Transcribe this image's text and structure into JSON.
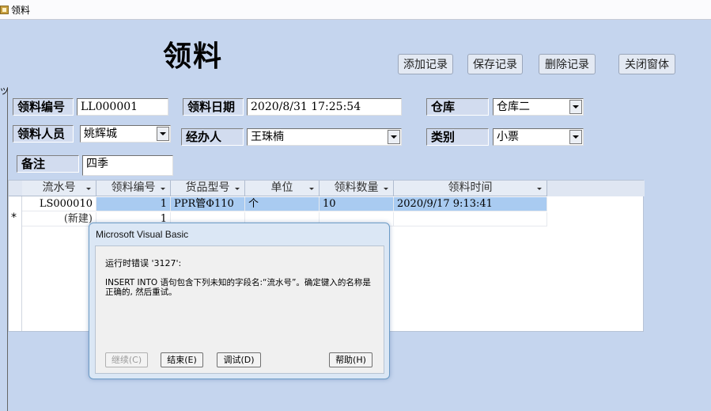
{
  "window": {
    "title": "领料"
  },
  "left_edge_mark": "ツ",
  "form": {
    "title": "领料"
  },
  "toolbar": {
    "add_label": "添加记录",
    "save_label": "保存记录",
    "delete_label": "删除记录",
    "close_label": "关闭窗体"
  },
  "fields": {
    "issue_no_label": "领料编号",
    "issue_no_value": "LL000001",
    "issue_date_label": "领料日期",
    "issue_date_value": "2020/8/31 17:25:54",
    "warehouse_label": "仓库",
    "warehouse_value": "仓库二",
    "requester_label": "领料人员",
    "requester_value": "姚辉城",
    "handler_label": "经办人",
    "handler_value": "王珠楠",
    "category_label": "类别",
    "category_value": "小票",
    "note_label": "备注",
    "note_value": "四季"
  },
  "grid": {
    "columns": [
      "流水号",
      "领料编号",
      "货品型号",
      "单位",
      "领料数量",
      "领料时间"
    ],
    "rows": [
      {
        "serial": "LS000010",
        "issue_no": "1",
        "model": "PPR管Φ110",
        "unit": "个",
        "qty": "10",
        "time": "2020/9/17 9:13:41"
      }
    ],
    "new_row": {
      "marker": "*",
      "serial": "(新建)",
      "issue_no": "1"
    }
  },
  "dialog": {
    "title": "Microsoft Visual Basic",
    "error_title": "运行时错误 '3127':",
    "error_message": "INSERT INTO 语句包含下列未知的字段名:“流水号”。确定键入的名称是正确的, 然后重试。",
    "buttons": {
      "continue": "继续(C)",
      "end": "结束(E)",
      "debug": "调试(D)",
      "help": "帮助(H)"
    }
  }
}
